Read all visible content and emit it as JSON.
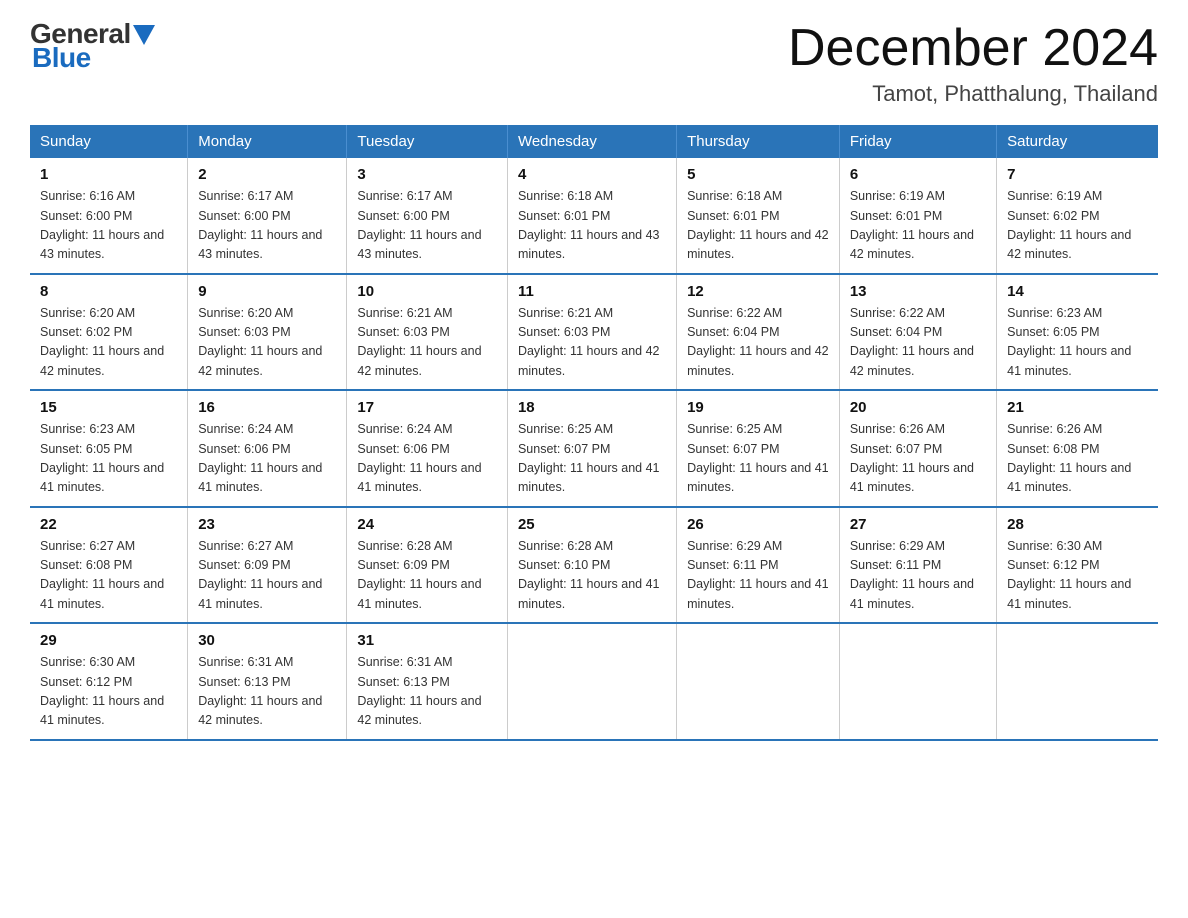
{
  "logo": {
    "general": "General",
    "blue": "Blue"
  },
  "title": "December 2024",
  "subtitle": "Tamot, Phatthalung, Thailand",
  "days_header": [
    "Sunday",
    "Monday",
    "Tuesday",
    "Wednesday",
    "Thursday",
    "Friday",
    "Saturday"
  ],
  "weeks": [
    [
      {
        "num": "1",
        "sunrise": "6:16 AM",
        "sunset": "6:00 PM",
        "daylight": "11 hours and 43 minutes."
      },
      {
        "num": "2",
        "sunrise": "6:17 AM",
        "sunset": "6:00 PM",
        "daylight": "11 hours and 43 minutes."
      },
      {
        "num": "3",
        "sunrise": "6:17 AM",
        "sunset": "6:00 PM",
        "daylight": "11 hours and 43 minutes."
      },
      {
        "num": "4",
        "sunrise": "6:18 AM",
        "sunset": "6:01 PM",
        "daylight": "11 hours and 43 minutes."
      },
      {
        "num": "5",
        "sunrise": "6:18 AM",
        "sunset": "6:01 PM",
        "daylight": "11 hours and 42 minutes."
      },
      {
        "num": "6",
        "sunrise": "6:19 AM",
        "sunset": "6:01 PM",
        "daylight": "11 hours and 42 minutes."
      },
      {
        "num": "7",
        "sunrise": "6:19 AM",
        "sunset": "6:02 PM",
        "daylight": "11 hours and 42 minutes."
      }
    ],
    [
      {
        "num": "8",
        "sunrise": "6:20 AM",
        "sunset": "6:02 PM",
        "daylight": "11 hours and 42 minutes."
      },
      {
        "num": "9",
        "sunrise": "6:20 AM",
        "sunset": "6:03 PM",
        "daylight": "11 hours and 42 minutes."
      },
      {
        "num": "10",
        "sunrise": "6:21 AM",
        "sunset": "6:03 PM",
        "daylight": "11 hours and 42 minutes."
      },
      {
        "num": "11",
        "sunrise": "6:21 AM",
        "sunset": "6:03 PM",
        "daylight": "11 hours and 42 minutes."
      },
      {
        "num": "12",
        "sunrise": "6:22 AM",
        "sunset": "6:04 PM",
        "daylight": "11 hours and 42 minutes."
      },
      {
        "num": "13",
        "sunrise": "6:22 AM",
        "sunset": "6:04 PM",
        "daylight": "11 hours and 42 minutes."
      },
      {
        "num": "14",
        "sunrise": "6:23 AM",
        "sunset": "6:05 PM",
        "daylight": "11 hours and 41 minutes."
      }
    ],
    [
      {
        "num": "15",
        "sunrise": "6:23 AM",
        "sunset": "6:05 PM",
        "daylight": "11 hours and 41 minutes."
      },
      {
        "num": "16",
        "sunrise": "6:24 AM",
        "sunset": "6:06 PM",
        "daylight": "11 hours and 41 minutes."
      },
      {
        "num": "17",
        "sunrise": "6:24 AM",
        "sunset": "6:06 PM",
        "daylight": "11 hours and 41 minutes."
      },
      {
        "num": "18",
        "sunrise": "6:25 AM",
        "sunset": "6:07 PM",
        "daylight": "11 hours and 41 minutes."
      },
      {
        "num": "19",
        "sunrise": "6:25 AM",
        "sunset": "6:07 PM",
        "daylight": "11 hours and 41 minutes."
      },
      {
        "num": "20",
        "sunrise": "6:26 AM",
        "sunset": "6:07 PM",
        "daylight": "11 hours and 41 minutes."
      },
      {
        "num": "21",
        "sunrise": "6:26 AM",
        "sunset": "6:08 PM",
        "daylight": "11 hours and 41 minutes."
      }
    ],
    [
      {
        "num": "22",
        "sunrise": "6:27 AM",
        "sunset": "6:08 PM",
        "daylight": "11 hours and 41 minutes."
      },
      {
        "num": "23",
        "sunrise": "6:27 AM",
        "sunset": "6:09 PM",
        "daylight": "11 hours and 41 minutes."
      },
      {
        "num": "24",
        "sunrise": "6:28 AM",
        "sunset": "6:09 PM",
        "daylight": "11 hours and 41 minutes."
      },
      {
        "num": "25",
        "sunrise": "6:28 AM",
        "sunset": "6:10 PM",
        "daylight": "11 hours and 41 minutes."
      },
      {
        "num": "26",
        "sunrise": "6:29 AM",
        "sunset": "6:11 PM",
        "daylight": "11 hours and 41 minutes."
      },
      {
        "num": "27",
        "sunrise": "6:29 AM",
        "sunset": "6:11 PM",
        "daylight": "11 hours and 41 minutes."
      },
      {
        "num": "28",
        "sunrise": "6:30 AM",
        "sunset": "6:12 PM",
        "daylight": "11 hours and 41 minutes."
      }
    ],
    [
      {
        "num": "29",
        "sunrise": "6:30 AM",
        "sunset": "6:12 PM",
        "daylight": "11 hours and 41 minutes."
      },
      {
        "num": "30",
        "sunrise": "6:31 AM",
        "sunset": "6:13 PM",
        "daylight": "11 hours and 42 minutes."
      },
      {
        "num": "31",
        "sunrise": "6:31 AM",
        "sunset": "6:13 PM",
        "daylight": "11 hours and 42 minutes."
      },
      null,
      null,
      null,
      null
    ]
  ]
}
